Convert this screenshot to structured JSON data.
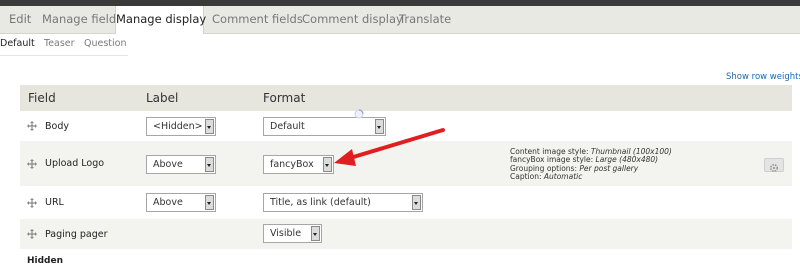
{
  "tabs": [
    {
      "label": "Edit",
      "active": false
    },
    {
      "label": "Manage fields",
      "active": false
    },
    {
      "label": "Manage display",
      "active": true
    },
    {
      "label": "Comment fields",
      "active": false
    },
    {
      "label": "Comment display",
      "active": false
    },
    {
      "label": "Translate",
      "active": false
    }
  ],
  "subtabs": [
    {
      "label": "Default",
      "active": true
    },
    {
      "label": "Teaser",
      "active": false
    },
    {
      "label": "Question",
      "active": false
    }
  ],
  "row_weights_link": "Show row weights",
  "table": {
    "headers": {
      "field": "Field",
      "label": "Label",
      "format": "Format"
    },
    "rows": [
      {
        "name": "Body",
        "label": "<Hidden>",
        "format": "Default"
      },
      {
        "name": "Upload Logo",
        "label": "Above",
        "format": "fancyBox"
      },
      {
        "name": "URL",
        "label": "Above",
        "format": "Title, as link (default)"
      },
      {
        "name": "Paging pager",
        "label": "",
        "format": "Visible"
      }
    ]
  },
  "upload_logo_summary": {
    "line1_label": "Content image style: ",
    "line1_value": "Thumbnail (100x100)",
    "line2_label": "fancyBox image style: ",
    "line2_value": "Large (480x480)",
    "line3_label": "Grouping options: ",
    "line3_value": "Per post gallery",
    "line4_label": "Caption: ",
    "line4_value": "Automatic"
  },
  "hidden_section_label": "Hidden",
  "colors": {
    "annotation_arrow": "#e02020",
    "link": "#2266aa",
    "header_bg": "#e6e6df",
    "row_alt_bg": "#f3f3ef"
  },
  "icons": {
    "drag": "move-handle-icon",
    "settings": "gear-icon",
    "annotation": "red-arrow-icon"
  }
}
